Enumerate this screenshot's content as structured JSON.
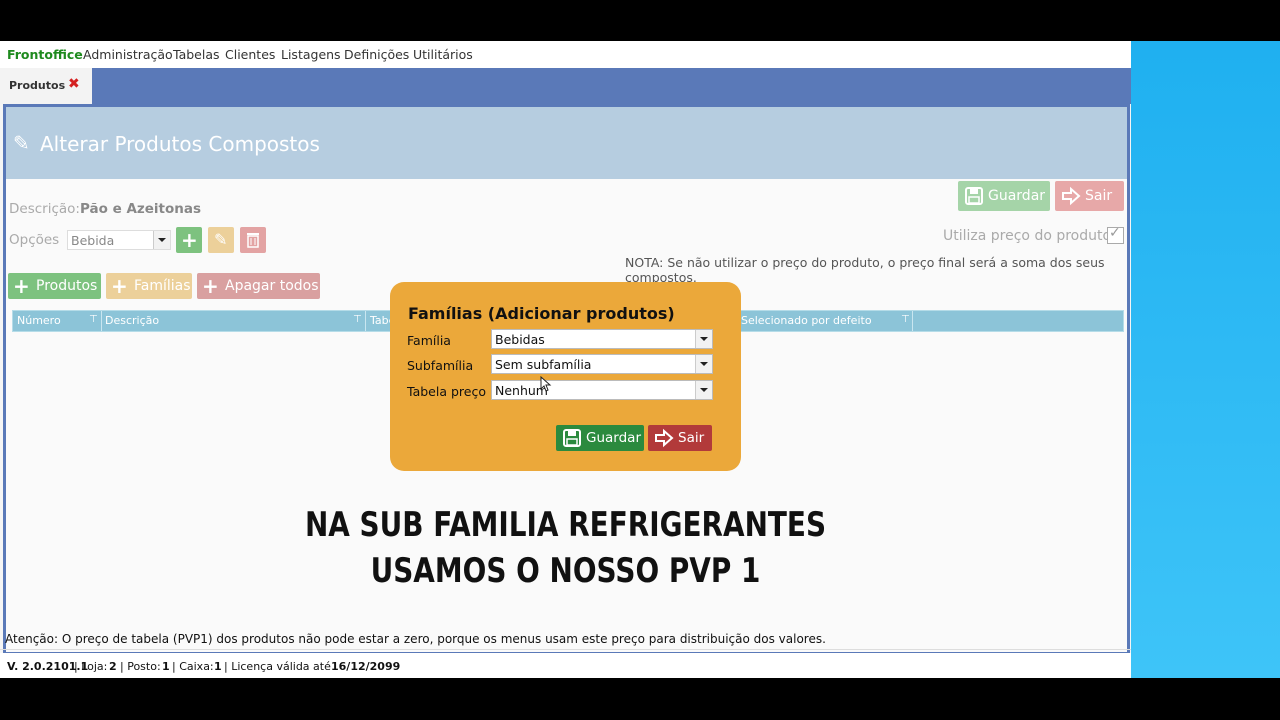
{
  "menu": {
    "items": [
      "Frontoffice",
      "Administração",
      "Tabelas",
      "Clientes",
      "Listagens",
      "Definições",
      "Utilitários"
    ]
  },
  "tab": {
    "label": "Produtos"
  },
  "page": {
    "title": "Alterar Produtos Compostos"
  },
  "actions": {
    "save_label": "Guardar",
    "exit_label": "Sair"
  },
  "form": {
    "description_label": "Descrição:",
    "description_value": "Pão e Azeitonas",
    "options_label": "Opções",
    "options_value": "Bebida",
    "use_price_label": "Utiliza preço do produto",
    "note": "NOTA: Se não utilizar o preço do produto, o preço final será a soma dos seus compostos."
  },
  "toolbar": {
    "products_label": "Produtos",
    "families_label": "Famílias",
    "delete_all_label": "Apagar todos"
  },
  "grid": {
    "columns": [
      "Número",
      "Descrição",
      "Tabe",
      "Selecionado por defeito"
    ]
  },
  "dialog": {
    "title": "Famílias (Adicionar produtos)",
    "family_label": "Família",
    "family_value": "Bebidas",
    "subfamily_label": "Subfamília",
    "subfamily_value": "Sem subfamília",
    "price_table_label": "Tabela preço",
    "price_table_value": "Nenhum",
    "save_label": "Guardar",
    "exit_label": "Sair"
  },
  "caption": {
    "line1": "NA SUB FAMILIA REFRIGERANTES",
    "line2": "USAMOS O NOSSO PVP 1"
  },
  "warning": "Atenção: O preço de tabela (PVP1) dos produtos não pode estar a zero, porque os menus usam este preço para distribuição dos valores.",
  "status": {
    "version": "V. 2.0.2101.1",
    "store_label": "| Loja:",
    "store_value": "2",
    "post_label": "| Posto:",
    "post_value": "1",
    "cash_label": "| Caixa:",
    "cash_value": "1",
    "license_label": "| Licença válida até",
    "license_value": "16/12/2099"
  },
  "colors": {
    "accent": "#5a79b8",
    "green": "#2b8a3e",
    "red": "#b23a3a",
    "dialog": "#eba83a"
  }
}
